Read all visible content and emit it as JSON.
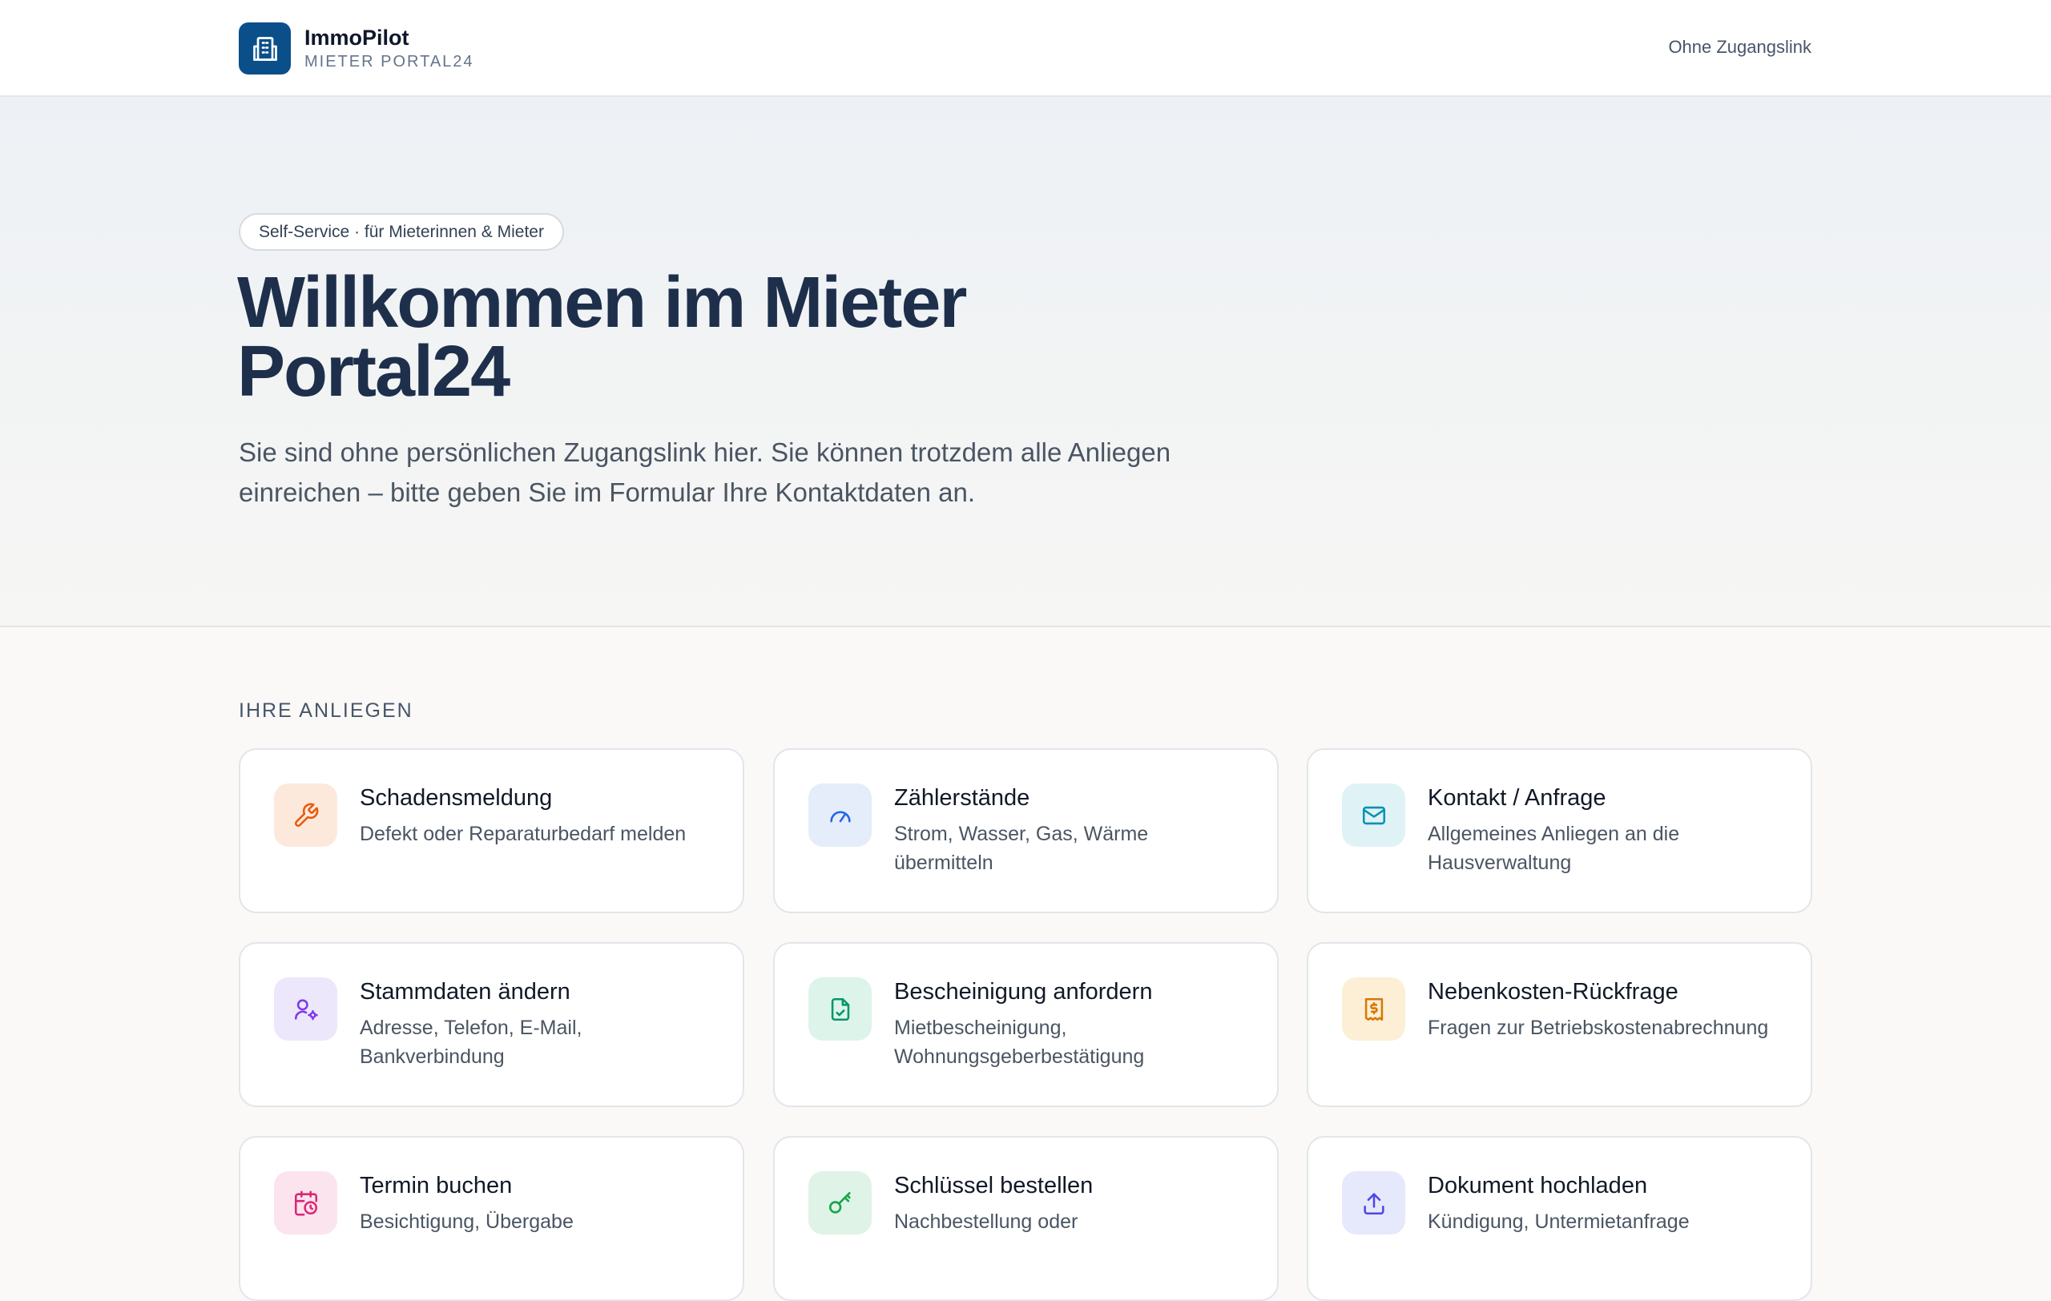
{
  "header": {
    "brand_name": "ImmoPilot",
    "brand_sub": "MIETER PORTAL24",
    "link": "Ohne Zugangslink"
  },
  "hero": {
    "pill": "Self-Service · für Mieterinnen & Mieter",
    "title": "Willkommen im Mieter Portal24",
    "text": "Sie sind ohne persönlichen Zugangslink hier. Sie können trotzdem alle Anliegen einreichen – bitte geben Sie im Formular Ihre Kontaktdaten an."
  },
  "section": {
    "label": "IHRE ANLIEGEN"
  },
  "cards": [
    {
      "title": "Schadensmeldung",
      "desc": "Defekt oder Reparaturbedarf melden",
      "icon": "wrench-icon",
      "color": "#ea580c",
      "bg": "#fde9dc"
    },
    {
      "title": "Zählerstände",
      "desc": "Strom, Wasser, Gas, Wärme übermitteln",
      "icon": "gauge-icon",
      "color": "#2563eb",
      "bg": "#e4edf9"
    },
    {
      "title": "Kontakt / Anfrage",
      "desc": "Allgemeines Anliegen an die Hausverwaltung",
      "icon": "mail-icon",
      "color": "#0891b2",
      "bg": "#dff3f6"
    },
    {
      "title": "Stammdaten ändern",
      "desc": "Adresse, Telefon, E-Mail, Bankverbindung",
      "icon": "user-settings-icon",
      "color": "#7c3aed",
      "bg": "#ede7fb"
    },
    {
      "title": "Bescheinigung anfordern",
      "desc": "Mietbescheinigung, Wohnungsgeberbestätigung",
      "icon": "file-check-icon",
      "color": "#059669",
      "bg": "#ddf4ea"
    },
    {
      "title": "Nebenkosten-Rückfrage",
      "desc": "Fragen zur Betriebskostenabrechnung",
      "icon": "receipt-icon",
      "color": "#d97706",
      "bg": "#fcefd6"
    },
    {
      "title": "Termin buchen",
      "desc": "Besichtigung, Übergabe",
      "icon": "calendar-clock-icon",
      "color": "#db2777",
      "bg": "#fce4ee"
    },
    {
      "title": "Schlüssel bestellen",
      "desc": "Nachbestellung oder",
      "icon": "key-icon",
      "color": "#16a34a",
      "bg": "#dff3e6"
    },
    {
      "title": "Dokument hochladen",
      "desc": "Kündigung, Untermietanfrage",
      "icon": "upload-icon",
      "color": "#4f46e5",
      "bg": "#e6e8fb"
    }
  ]
}
